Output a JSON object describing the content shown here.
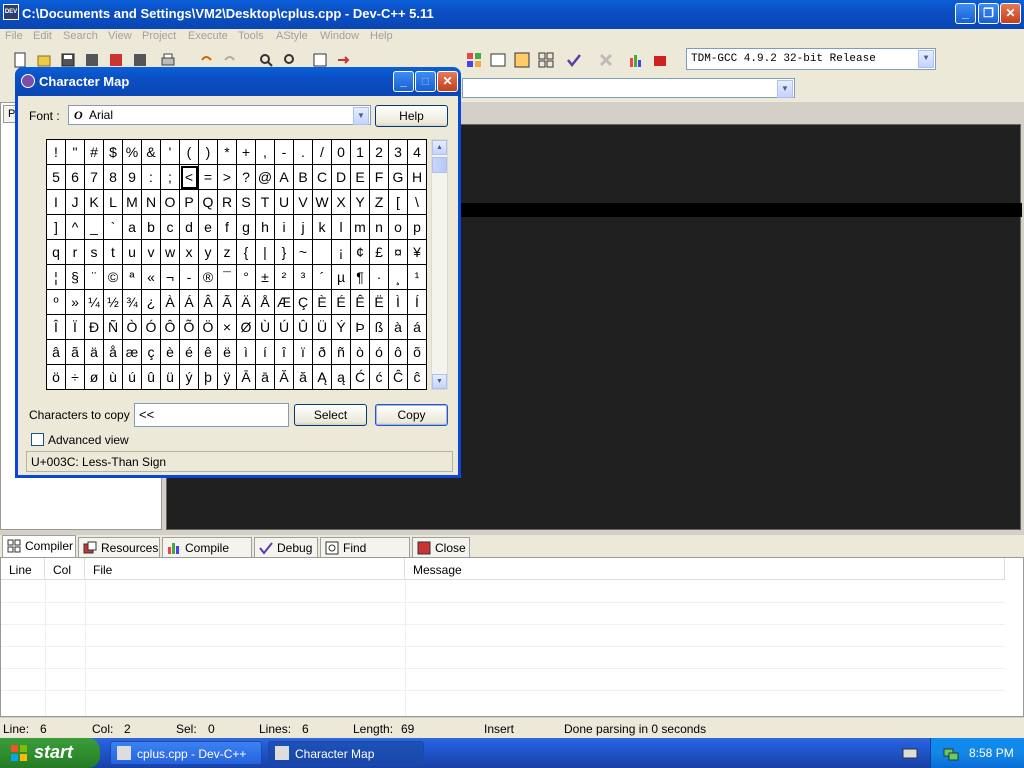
{
  "main_window": {
    "title": "C:\\Documents and Settings\\VM2\\Desktop\\cplus.cpp - Dev-C++ 5.11",
    "app_icon_text": "DEV"
  },
  "menu": [
    "File",
    "Edit",
    "Search",
    "View",
    "Project",
    "Execute",
    "Tools",
    "AStyle",
    "Window",
    "Help"
  ],
  "compiler_select": "TDM-GCC 4.9.2 32-bit Release",
  "left_tab_label": "P",
  "bottom_tabs": [
    {
      "label": "Compiler",
      "icon": "compiler-icon"
    },
    {
      "label": "Resources",
      "icon": "resources-icon"
    },
    {
      "label": "Compile Log",
      "icon": "compile-log-icon"
    },
    {
      "label": "Debug",
      "icon": "debug-icon"
    },
    {
      "label": "Find Results",
      "icon": "find-results-icon"
    },
    {
      "label": "Close",
      "icon": "close-icon"
    }
  ],
  "messages_columns": [
    "Line",
    "Col",
    "File",
    "Message"
  ],
  "status": {
    "line_label": "Line:",
    "line_value": "6",
    "col_label": "Col:",
    "col_value": "2",
    "sel_label": "Sel:",
    "sel_value": "0",
    "lines_label": "Lines:",
    "lines_value": "6",
    "length_label": "Length:",
    "length_value": "69",
    "mode": "Insert",
    "message": "Done parsing in 0 seconds"
  },
  "taskbar": {
    "start": "start",
    "tasks": [
      "cplus.cpp - Dev-C++",
      "Character Map"
    ],
    "time": "8:58 PM"
  },
  "charmap": {
    "title": "Character Map",
    "font_label": "Font :",
    "font_value": "Arial",
    "help_button": "Help",
    "chars": [
      "!",
      "\"",
      "#",
      "$",
      "%",
      "&",
      "'",
      "(",
      ")",
      "*",
      "+",
      ",",
      "-",
      ".",
      "/",
      "0",
      "1",
      "2",
      "3",
      "4",
      "5",
      "6",
      "7",
      "8",
      "9",
      ":",
      ";",
      "<",
      "=",
      ">",
      "?",
      "@",
      "A",
      "B",
      "C",
      "D",
      "E",
      "F",
      "G",
      "H",
      "I",
      "J",
      "K",
      "L",
      "M",
      "N",
      "O",
      "P",
      "Q",
      "R",
      "S",
      "T",
      "U",
      "V",
      "W",
      "X",
      "Y",
      "Z",
      "[",
      "\\",
      "]",
      "^",
      "_",
      "`",
      "a",
      "b",
      "c",
      "d",
      "e",
      "f",
      "g",
      "h",
      "i",
      "j",
      "k",
      "l",
      "m",
      "n",
      "o",
      "p",
      "q",
      "r",
      "s",
      "t",
      "u",
      "v",
      "w",
      "x",
      "y",
      "z",
      "{",
      "|",
      "}",
      "~",
      " ",
      "¡",
      "¢",
      "£",
      "¤",
      "¥",
      "¦",
      "§",
      "¨",
      "©",
      "ª",
      "«",
      "¬",
      "-",
      "®",
      "¯",
      "°",
      "±",
      "²",
      "³",
      "´",
      "µ",
      "¶",
      "·",
      "¸",
      "¹",
      "º",
      "»",
      "¼",
      "½",
      "¾",
      "¿",
      "À",
      "Á",
      "Â",
      "Ã",
      "Ä",
      "Å",
      "Æ",
      "Ç",
      "È",
      "É",
      "Ê",
      "Ë",
      "Ì",
      "Í",
      "Î",
      "Ï",
      "Ð",
      "Ñ",
      "Ò",
      "Ó",
      "Ô",
      "Õ",
      "Ö",
      "×",
      "Ø",
      "Ù",
      "Ú",
      "Û",
      "Ü",
      "Ý",
      "Þ",
      "ß",
      "à",
      "á",
      "â",
      "ã",
      "ä",
      "å",
      "æ",
      "ç",
      "è",
      "é",
      "ê",
      "ë",
      "ì",
      "í",
      "î",
      "ï",
      "ð",
      "ñ",
      "ò",
      "ó",
      "ô",
      "õ",
      "ö",
      "÷",
      "ø",
      "ù",
      "ú",
      "û",
      "ü",
      "ý",
      "þ",
      "ÿ",
      "Ā",
      "ā",
      "Ă",
      "ă",
      "Ą",
      "ą",
      "Ć",
      "ć",
      "Ĉ",
      "ĉ"
    ],
    "selected_char": "<",
    "chars_to_copy_label": "Characters to copy :",
    "chars_to_copy_value": "<<",
    "select_button": "Select",
    "copy_button": "Copy",
    "advanced_view_label": "Advanced view",
    "advanced_view_checked": false,
    "status_text": "U+003C: Less-Than Sign"
  }
}
